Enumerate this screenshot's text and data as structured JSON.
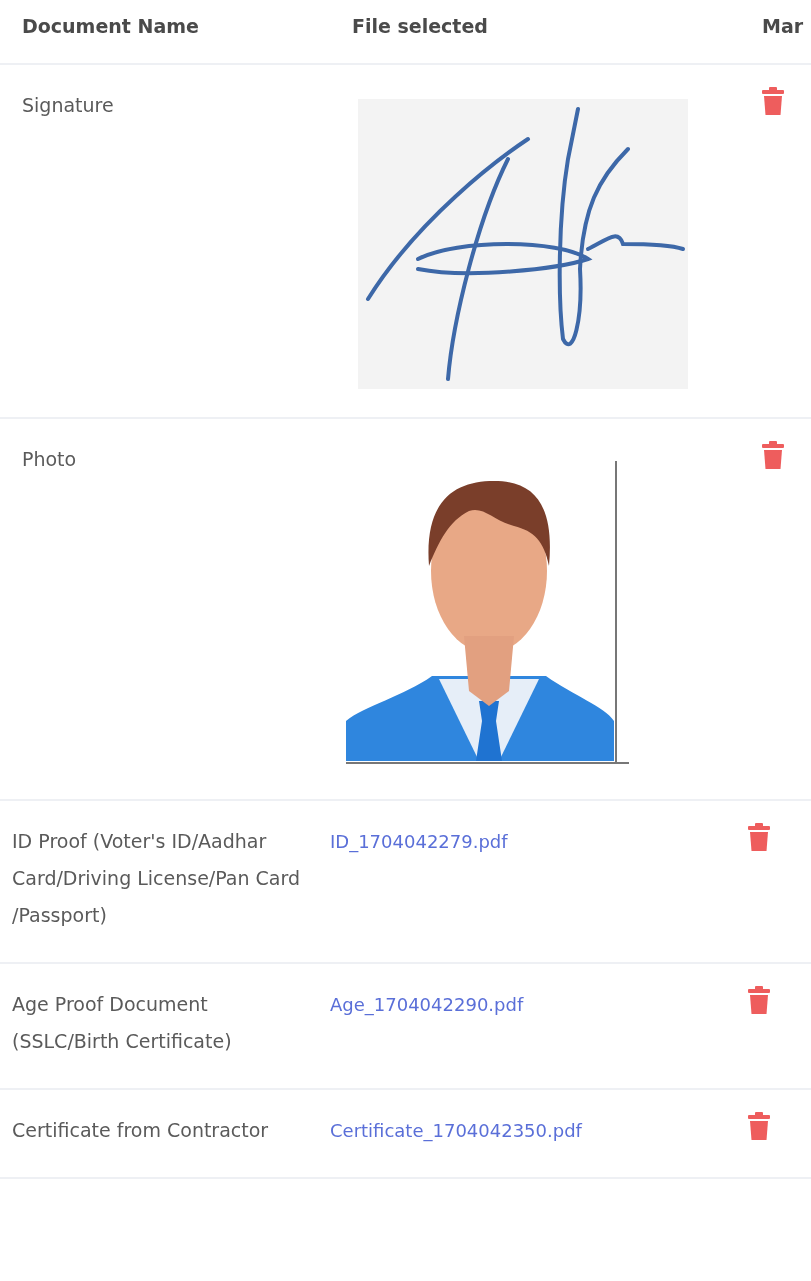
{
  "table": {
    "columns": [
      "Document Name",
      "File selected",
      "Mar"
    ],
    "rows": [
      {
        "document_name": "Signature",
        "file": {
          "kind": "signature_image"
        }
      },
      {
        "document_name": "Photo",
        "file": {
          "kind": "photo_image"
        }
      },
      {
        "document_name": "ID Proof (Voter's ID/Aadhar Card/Driving License/Pan Card /Passport)",
        "file": {
          "kind": "file_link",
          "name": "ID_1704042279.pdf"
        }
      },
      {
        "document_name": "Age Proof Document (SSLC/Birth Certificate)",
        "file": {
          "kind": "file_link",
          "name": "Age_1704042290.pdf"
        }
      },
      {
        "document_name": "Certificate from Contractor",
        "file": {
          "kind": "file_link",
          "name": "Certificate_1704042350.pdf"
        }
      }
    ]
  }
}
